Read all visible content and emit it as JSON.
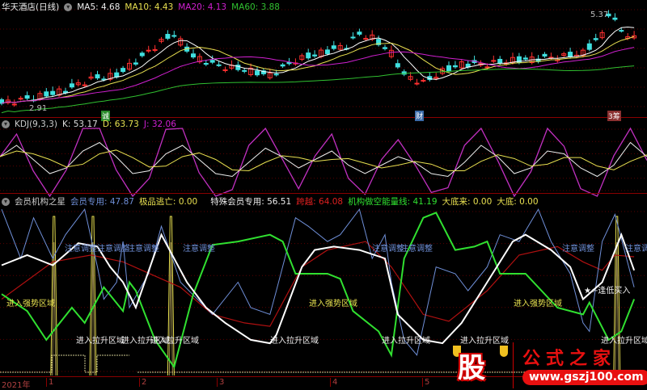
{
  "price_panel": {
    "stock_name": "华天酒店(日线)",
    "ma5": "MA5: 4.68",
    "ma10": "MA10: 4.43",
    "ma20": "MA20: 4.13",
    "ma60": "MA60: 3.88",
    "low_label": "2.91",
    "high_label": "5.37",
    "badges": [
      {
        "text": "诚",
        "color": "#2a8a2a"
      },
      {
        "text": "财",
        "color": "#3a6aa8"
      },
      {
        "text": "3筹",
        "color": "#8a3030"
      }
    ],
    "colors": {
      "ma5": "#ffffff",
      "ma10": "#e8e050",
      "ma20": "#d020d0",
      "ma60": "#30c030",
      "up": "#ff3030",
      "down": "#40e0e0"
    }
  },
  "kdj_panel": {
    "title": "KDJ(9,3,3)",
    "k": "K: 53.17",
    "d": "D: 63.73",
    "j": "J: 32.06"
  },
  "indicator_panel": {
    "title": "会员机构之星",
    "member": "会员专用: 47.87",
    "escape": "极品逃亡: 0.00",
    "special": "特殊会员专用: 56.51",
    "cross": "跨越: 64.08",
    "short_energy": "机构做空能量线: 41.19",
    "bottom_coming": "大底来: 0.00",
    "bottom": "大底: 0.00",
    "labels": {
      "adjust": "注意调整",
      "strong": "进入强势区域",
      "rise": "进入拉升区域",
      "buy": "逢低买入"
    }
  },
  "axis": {
    "year": "2021年",
    "months": [
      "1",
      "2",
      "3",
      "4",
      "5"
    ]
  },
  "watermark": {
    "char": "股",
    "name": "公式之家",
    "url": "www.gszj100.com"
  },
  "chart_data": {
    "type": "line",
    "price_path": [
      [
        0,
        2.95
      ],
      [
        5,
        3.1
      ],
      [
        10,
        3.3
      ],
      [
        14,
        3.6
      ],
      [
        18,
        3.7
      ],
      [
        22,
        4.2
      ],
      [
        25,
        4.6
      ],
      [
        27,
        4.8
      ],
      [
        30,
        4.2
      ],
      [
        34,
        3.95
      ],
      [
        38,
        3.85
      ],
      [
        42,
        3.7
      ],
      [
        46,
        4.1
      ],
      [
        50,
        4.3
      ],
      [
        54,
        4.5
      ],
      [
        56,
        4.8
      ],
      [
        58,
        4.7
      ],
      [
        61,
        4.3
      ],
      [
        63,
        3.7
      ],
      [
        66,
        3.5
      ],
      [
        69,
        3.8
      ],
      [
        72,
        4.0
      ],
      [
        76,
        4.0
      ],
      [
        80,
        4.1
      ],
      [
        84,
        4.15
      ],
      [
        88,
        4.2
      ],
      [
        91,
        4.3
      ],
      [
        94,
        4.8
      ],
      [
        95,
        5.37
      ],
      [
        97,
        4.9
      ],
      [
        99,
        4.68
      ]
    ],
    "kdj_k": [
      60,
      80,
      55,
      30,
      40,
      70,
      85,
      60,
      30,
      35,
      65,
      80,
      55,
      30,
      25,
      50,
      75,
      60,
      40,
      55,
      70,
      45,
      30,
      45,
      60,
      50,
      30,
      25,
      50,
      80,
      60,
      30,
      40,
      70,
      65,
      40,
      25,
      45,
      85,
      60
    ],
    "member": [
      [
        0,
        65
      ],
      [
        4,
        71
      ],
      [
        8,
        65
      ],
      [
        12,
        78
      ],
      [
        15,
        76
      ],
      [
        17,
        64
      ],
      [
        19,
        55
      ],
      [
        21,
        40
      ],
      [
        25,
        83
      ],
      [
        29,
        55
      ],
      [
        32,
        40
      ],
      [
        35,
        31
      ],
      [
        39,
        21
      ],
      [
        42,
        19
      ],
      [
        43,
        24
      ],
      [
        47,
        64
      ],
      [
        49,
        74
      ],
      [
        52,
        76
      ],
      [
        56,
        74
      ],
      [
        60,
        69
      ],
      [
        62,
        36
      ],
      [
        66,
        21
      ],
      [
        69,
        19
      ],
      [
        72,
        31
      ],
      [
        76,
        55
      ],
      [
        80,
        79
      ],
      [
        82,
        83
      ],
      [
        86,
        74
      ],
      [
        89,
        64
      ],
      [
        91,
        45
      ],
      [
        94,
        55
      ],
      [
        97,
        83
      ],
      [
        99,
        62
      ]
    ],
    "special": [
      [
        0,
        98
      ],
      [
        3,
        69
      ],
      [
        5,
        93
      ],
      [
        8,
        69
      ],
      [
        10,
        83
      ],
      [
        13,
        98
      ],
      [
        15,
        64
      ],
      [
        16,
        45
      ],
      [
        18,
        55
      ],
      [
        19,
        79
      ],
      [
        20,
        40
      ],
      [
        23,
        60
      ],
      [
        25,
        88
      ],
      [
        28,
        55
      ],
      [
        33,
        36
      ],
      [
        37,
        55
      ],
      [
        39,
        40
      ],
      [
        42,
        36
      ],
      [
        43,
        50
      ],
      [
        46,
        93
      ],
      [
        48,
        88
      ],
      [
        51,
        79
      ],
      [
        53,
        83
      ],
      [
        56,
        98
      ],
      [
        58,
        69
      ],
      [
        60,
        83
      ],
      [
        61,
        55
      ],
      [
        63,
        21
      ],
      [
        65,
        12
      ],
      [
        68,
        64
      ],
      [
        71,
        60
      ],
      [
        73,
        50
      ],
      [
        76,
        64
      ],
      [
        78,
        83
      ],
      [
        81,
        79
      ],
      [
        84,
        98
      ],
      [
        86,
        79
      ],
      [
        89,
        60
      ],
      [
        91,
        31
      ],
      [
        92,
        26
      ],
      [
        94,
        79
      ],
      [
        96,
        95
      ],
      [
        99,
        52
      ]
    ],
    "cross": [
      [
        0,
        45
      ],
      [
        8,
        67
      ],
      [
        14,
        71
      ],
      [
        19,
        67
      ],
      [
        25,
        57
      ],
      [
        28,
        52
      ],
      [
        33,
        36
      ],
      [
        38,
        31
      ],
      [
        42,
        29
      ],
      [
        47,
        64
      ],
      [
        51,
        74
      ],
      [
        57,
        79
      ],
      [
        61,
        64
      ],
      [
        66,
        36
      ],
      [
        70,
        32
      ],
      [
        76,
        50
      ],
      [
        81,
        71
      ],
      [
        87,
        76
      ],
      [
        91,
        67
      ],
      [
        94,
        62
      ],
      [
        96,
        71
      ],
      [
        99,
        70
      ]
    ],
    "short_energy": [
      [
        0,
        48
      ],
      [
        4,
        38
      ],
      [
        7,
        21
      ],
      [
        11,
        40
      ],
      [
        13,
        31
      ],
      [
        16,
        52
      ],
      [
        19,
        38
      ],
      [
        20,
        55
      ],
      [
        21,
        50
      ],
      [
        24,
        21
      ],
      [
        27,
        5
      ],
      [
        30,
        48
      ],
      [
        33,
        77
      ],
      [
        37,
        79
      ],
      [
        42,
        83
      ],
      [
        44,
        79
      ],
      [
        46,
        60
      ],
      [
        51,
        60
      ],
      [
        53,
        57
      ],
      [
        55,
        38
      ],
      [
        58,
        29
      ],
      [
        59,
        26
      ],
      [
        61,
        12
      ],
      [
        63,
        69
      ],
      [
        66,
        93
      ],
      [
        68,
        96
      ],
      [
        71,
        74
      ],
      [
        74,
        76
      ],
      [
        76,
        79
      ],
      [
        78,
        60
      ],
      [
        82,
        60
      ],
      [
        87,
        40
      ],
      [
        91,
        36
      ],
      [
        92,
        43
      ],
      [
        95,
        21
      ],
      [
        97,
        26
      ],
      [
        99,
        45
      ]
    ],
    "escape_spikes": [
      8.2,
      14.3,
      26.5,
      96.3
    ]
  }
}
